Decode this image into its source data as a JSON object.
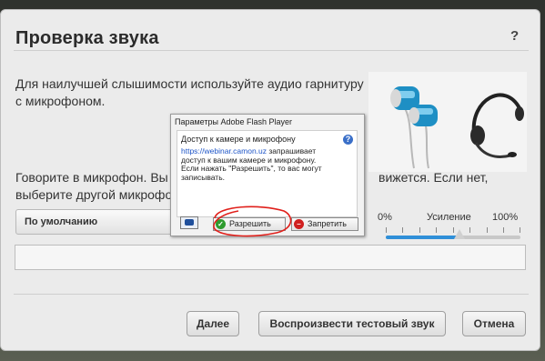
{
  "dialog": {
    "title": "Проверка звука",
    "help_label": "?",
    "intro_line1": "Для наилучшей слышимости используйте аудио гарнитуру",
    "intro_line2": "с микрофоном.",
    "speak_left_line1": "Говорите в микрофон. Вы",
    "speak_right_line1": "вижется. Если нет,",
    "speak_left_line2": "выберите другой микрофо",
    "microphone_select": {
      "value": "По умолчанию"
    },
    "volume": {
      "min_label": "0%",
      "gain_label": "Усиление",
      "max_label": "100%",
      "level_fraction": 0.55
    },
    "buttons": {
      "next": "Далее",
      "play_test": "Воспроизвести тестовый звук",
      "cancel": "Отмена"
    }
  },
  "flash_dialog": {
    "title": "Параметры Adobe Flash Player",
    "heading": "Доступ к камере и микрофону",
    "help_label": "?",
    "url": "https://webinar.camon.uz",
    "message_line1_suffix": " запрашивает",
    "message_line2": "доступ к вашим камере и микрофону.",
    "message_line3": "Если нажать \"Разрешить\", то вас могут",
    "message_line4": "записывать.",
    "allow_label": "Разрешить",
    "deny_label": "Запретить"
  },
  "colors": {
    "slider_fill": "#2f8fd8",
    "annotation_circle": "#e0201b",
    "allow_icon": "#2e9b2e",
    "deny_icon": "#d01f1f"
  },
  "icons": {
    "help": "question-icon",
    "camera": "camera-settings-icon",
    "allow": "checkmark-icon",
    "deny": "no-entry-icon"
  }
}
